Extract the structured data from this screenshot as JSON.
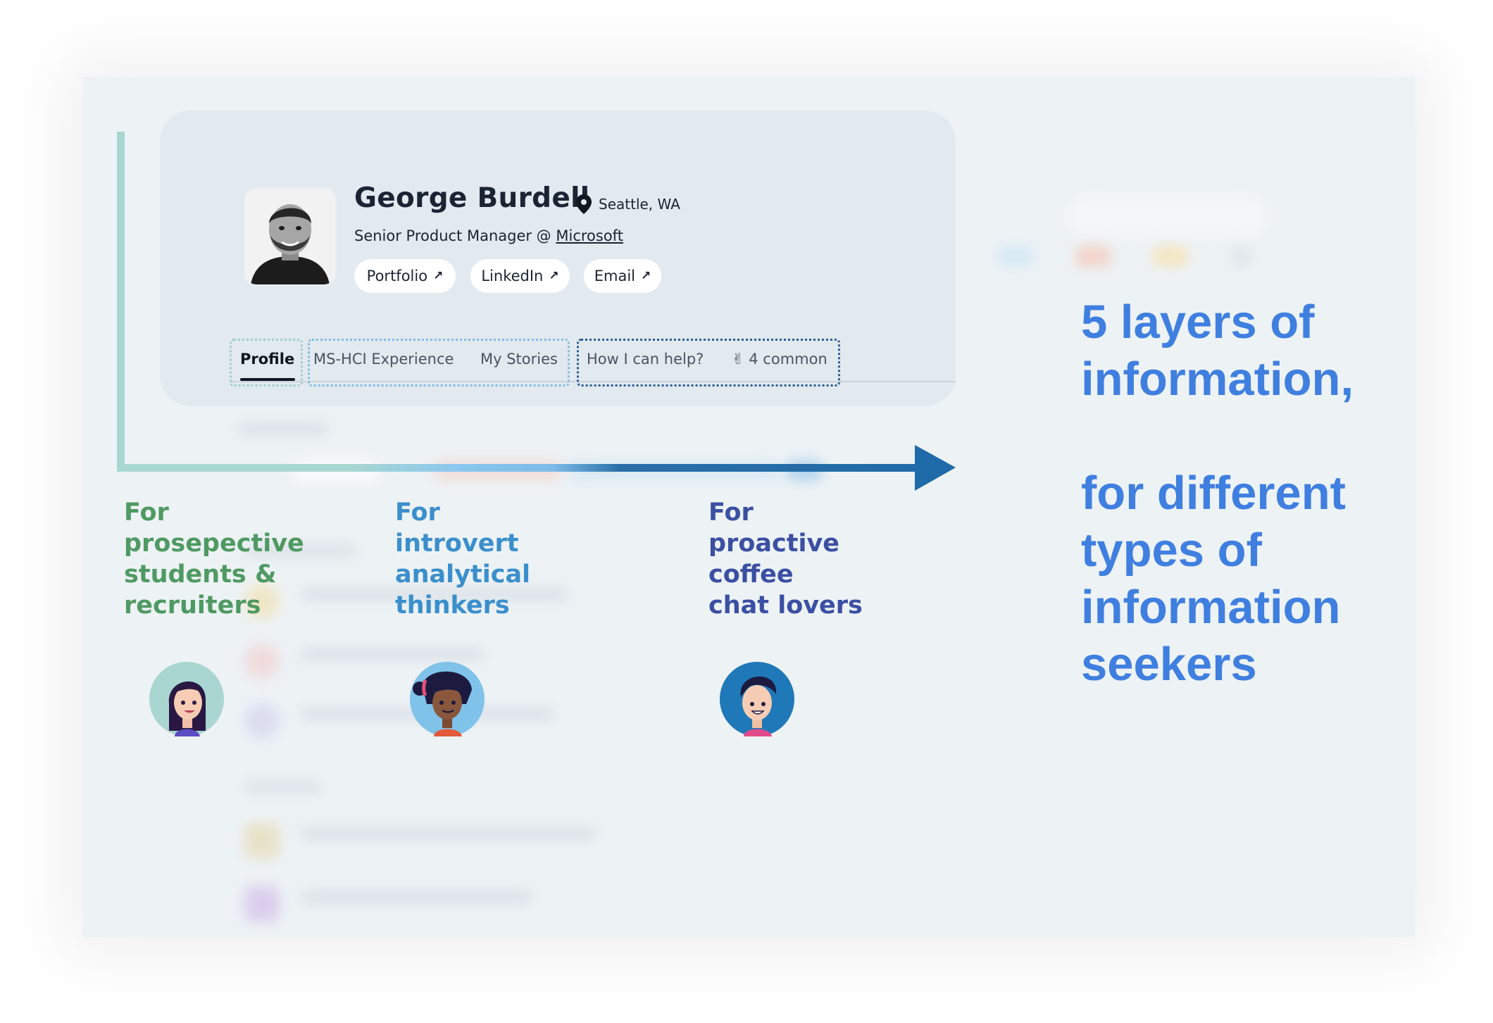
{
  "profile": {
    "name": "George Burdell",
    "location": "Seattle, WA",
    "role_prefix": "Senior Product Manager @ ",
    "company": "Microsoft",
    "links": [
      {
        "label": "Portfolio",
        "arrow": "↗"
      },
      {
        "label": "LinkedIn",
        "arrow": "↗"
      },
      {
        "label": "Email",
        "arrow": "↗"
      }
    ],
    "tabs": [
      {
        "label": "Profile"
      },
      {
        "label": "MS-HCI Experience"
      },
      {
        "label": "My Stories"
      },
      {
        "label": "How I can help?"
      },
      {
        "label": "✌ 4 common"
      }
    ]
  },
  "audiences": [
    {
      "lines": [
        "For",
        "prosepective",
        "students &",
        "recruiters"
      ],
      "color": "#4f9a62",
      "avatar_bg": "#a9d6d1"
    },
    {
      "lines": [
        "For",
        "introvert",
        "analytical",
        "thinkers"
      ],
      "color": "#3a8fcc",
      "avatar_bg": "#7fc2ea"
    },
    {
      "lines": [
        "For",
        "proactive",
        "coffee",
        "chat lovers"
      ],
      "color": "#3b4fa3",
      "avatar_bg": "#1f78b8"
    }
  ],
  "headline": {
    "part1": [
      "5 layers of",
      "information,"
    ],
    "part2": [
      "for different",
      "types of",
      "information",
      "seekers"
    ],
    "color": "#3f7fe0"
  },
  "icons": {
    "location": "map-pin-icon",
    "link_arrow": "arrow-up-right-icon"
  }
}
